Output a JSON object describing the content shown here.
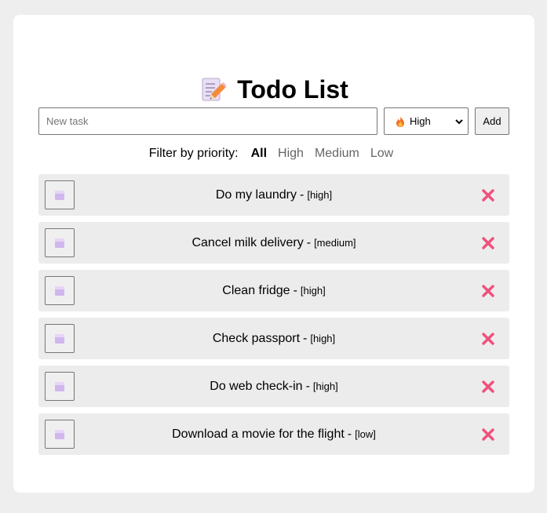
{
  "app": {
    "title": "Todo List",
    "title_icon": "memo-pencil-icon"
  },
  "form": {
    "input_placeholder": "New task",
    "input_value": "",
    "priority_selected": "High",
    "priority_icon": "fire-icon",
    "add_label": "Add"
  },
  "filter": {
    "label": "Filter by priority:",
    "options": [
      "All",
      "High",
      "Medium",
      "Low"
    ],
    "active": "All"
  },
  "todos": [
    {
      "text": "Do my laundry",
      "separator": "-",
      "priority": "[high]"
    },
    {
      "text": "Cancel milk delivery",
      "separator": "-",
      "priority": "[medium]"
    },
    {
      "text": "Clean fridge",
      "separator": "-",
      "priority": "[high]"
    },
    {
      "text": "Check passport",
      "separator": "-",
      "priority": "[high]"
    },
    {
      "text": "Do web check-in",
      "separator": "-",
      "priority": "[high]"
    },
    {
      "text": "Download a movie for the flight",
      "separator": "-",
      "priority": "[low]"
    }
  ],
  "colors": {
    "page_bg": "#eeeeee",
    "card_bg": "#ffffff",
    "row_bg": "#ececec",
    "delete_x": "#f0507a",
    "checkbox_square": "#c9a8e8"
  }
}
